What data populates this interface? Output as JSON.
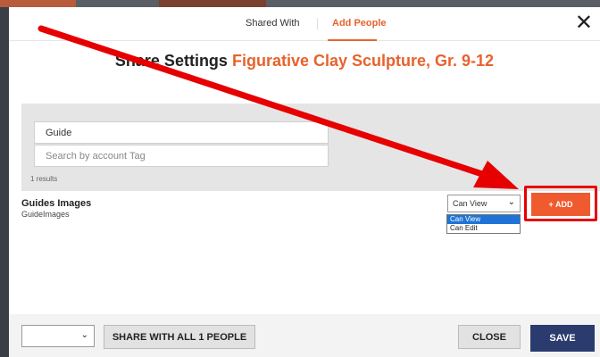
{
  "tabs": {
    "shared_with": "Shared With",
    "add_people": "Add People"
  },
  "close_symbol": "✕",
  "title": {
    "prefix": "Share Settings",
    "course": "Figurative Clay Sculpture, Gr. 9-12"
  },
  "search": {
    "guide_value": "Guide",
    "tag_placeholder": "Search by account Tag",
    "results": "1 results"
  },
  "result_item": {
    "name": "Guides Images",
    "account": "GuideImages"
  },
  "permission": {
    "selected": "Can View",
    "options": [
      "Can View",
      "Can Edit"
    ]
  },
  "add_button": "+ ADD",
  "footer": {
    "share_all": "SHARE WITH ALL 1 PEOPLE",
    "close": "CLOSE",
    "save": "SAVE"
  },
  "icons": {
    "close": "close-icon",
    "chevron": "chevron-down-icon"
  },
  "colors": {
    "accent": "#e8622c",
    "add_button": "#ef5b2e",
    "save_button": "#2b3b6e",
    "annotation_red": "#e60000"
  }
}
